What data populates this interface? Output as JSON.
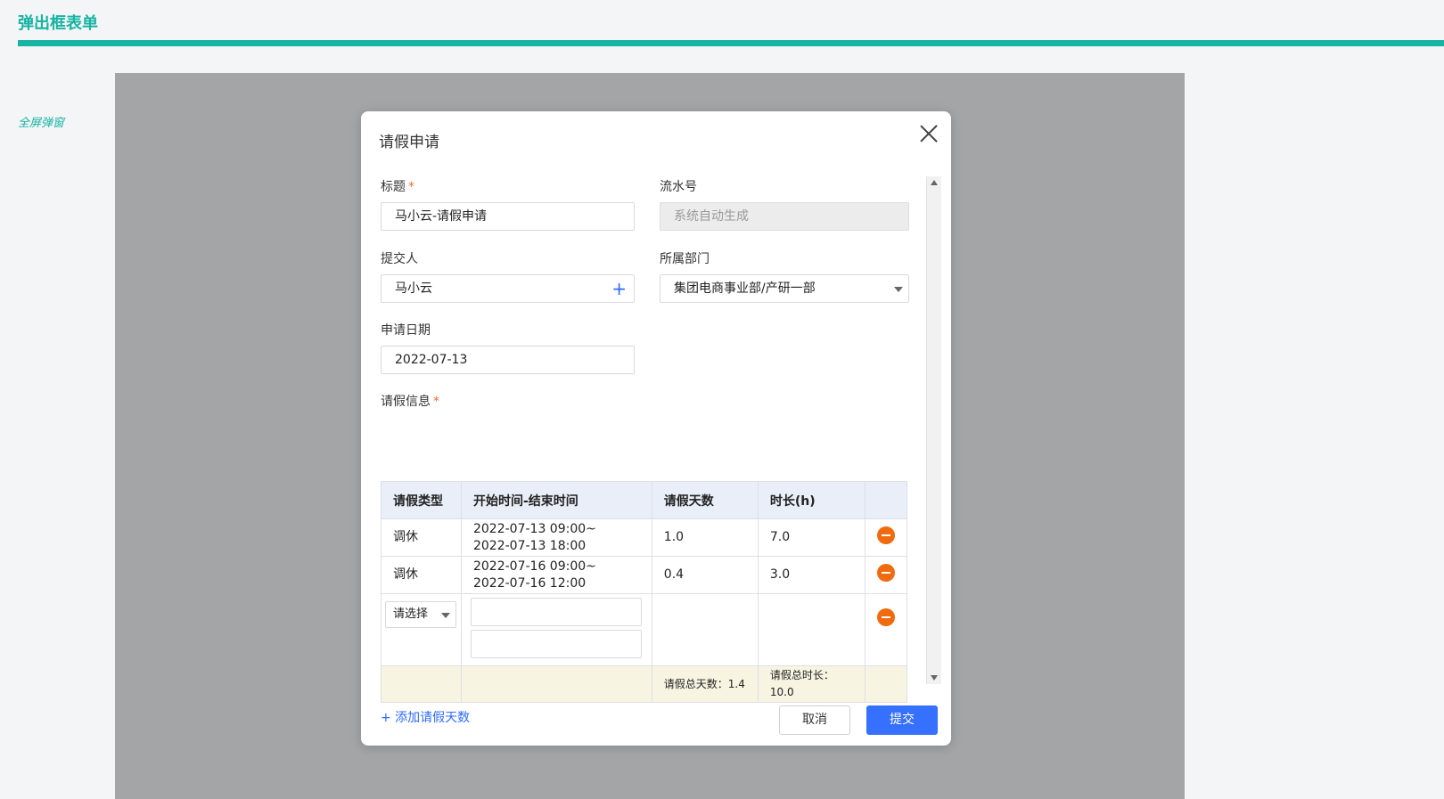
{
  "page": {
    "title": "弹出框表单",
    "side_label": "全屏弹窗"
  },
  "dialog": {
    "title": "请假申请",
    "fields": {
      "title_label": "标题",
      "title_value": "马小云-请假申请",
      "serial_label": "流水号",
      "serial_placeholder": "系统自动生成",
      "submitter_label": "提交人",
      "submitter_value": "马小云",
      "department_label": "所属部门",
      "department_value": "集团电商事业部/产研一部",
      "date_label": "申请日期",
      "date_value": "2022-07-13",
      "leave_info_label": "请假信息",
      "required_mark": "*"
    },
    "table": {
      "headers": [
        "请假类型",
        "开始时间-结束时间",
        "请假天数",
        "时长(h)"
      ],
      "rows": [
        {
          "type": "调休",
          "start": "2022-07-13 09:00~",
          "end": "2022-07-13 18:00",
          "days": "1.0",
          "hours": "7.0"
        },
        {
          "type": "调休",
          "start": "2022-07-16 09:00~",
          "end": "2022-07-16 12:00",
          "days": "0.4",
          "hours": "3.0"
        }
      ],
      "edit_row": {
        "type_placeholder": "请选择"
      },
      "summary": {
        "total_days": "请假总天数：1.4",
        "total_hours": "请假总时长：10.0"
      }
    },
    "add_link": "+ 添加请假天数",
    "buttons": {
      "cancel": "取消",
      "submit": "提交"
    }
  },
  "colors": {
    "accent": "#17b3a3",
    "primary": "#3570ff",
    "remove": "#f06a0f",
    "overlay": "#a4a5a7"
  }
}
